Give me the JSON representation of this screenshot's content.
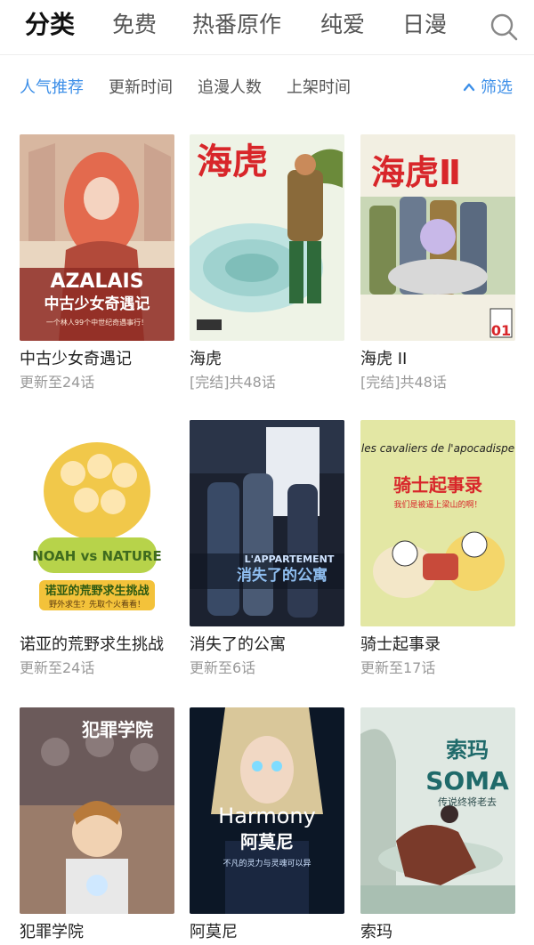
{
  "tabs": [
    {
      "label": "分类",
      "active": true
    },
    {
      "label": "免费",
      "active": false
    },
    {
      "label": "热番原作",
      "active": false
    },
    {
      "label": "纯爱",
      "active": false
    },
    {
      "label": "日漫",
      "active": false
    }
  ],
  "search": {
    "icon": "search-icon"
  },
  "sort_options": [
    {
      "label": "人气推荐",
      "active": true
    },
    {
      "label": "更新时间",
      "active": false
    },
    {
      "label": "追漫人数",
      "active": false
    },
    {
      "label": "上架时间",
      "active": false
    }
  ],
  "filter": {
    "label": "筛选",
    "icon": "chevron-up-icon"
  },
  "colors": {
    "accent": "#3d8fe8",
    "text": "#222222",
    "muted": "#999999"
  },
  "comics": [
    {
      "title": "中古少女奇遇记",
      "meta": "更新至24话",
      "cover_title": "AZALAIS",
      "cover_subtitle": "中古少女奇遇记",
      "cover_tagline": "一个林人99个中世纪奇遇事行！"
    },
    {
      "title": "海虎",
      "meta": "[完结]共48话",
      "cover_title": "海虎"
    },
    {
      "title": "海虎 II",
      "meta": "[完结]共48话",
      "cover_title": "海虎Ⅱ",
      "cover_badge": "01"
    },
    {
      "title": "诺亚的荒野求生挑战",
      "meta": "更新至24话",
      "cover_title": "NOAH vs NATURE",
      "cover_subtitle": "诺亚的荒野求生挑战",
      "cover_tagline": "野外求生？先取个火看看！"
    },
    {
      "title": "消失了的公寓",
      "meta": "更新至6话",
      "cover_title": "L'APPARTEMENT",
      "cover_subtitle": "消失了的公寓"
    },
    {
      "title": "骑士起事录",
      "meta": "更新至17话",
      "cover_title": "les cavaliers de l'apocadispe",
      "cover_subtitle": "骑士起事录",
      "cover_tagline": "我们是被逼上梁山的啊！"
    },
    {
      "title": "犯罪学院",
      "meta": "",
      "cover_title": "犯罪学院"
    },
    {
      "title": "阿莫尼",
      "meta": "",
      "cover_title": "Harmony",
      "cover_subtitle": "阿莫尼",
      "cover_tagline": "不凡的灵力与灵魂可以异"
    },
    {
      "title": "索玛",
      "meta": "",
      "cover_title": "索玛",
      "cover_subtitle": "SOMA",
      "cover_tagline": "传说终将老去"
    }
  ]
}
